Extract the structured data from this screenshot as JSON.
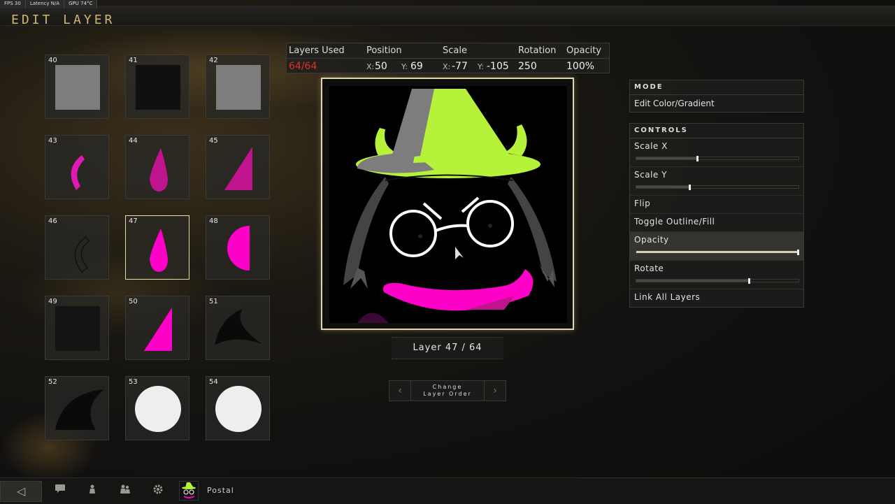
{
  "perf": {
    "fps": "FPS 30",
    "latency": "Latency N/A",
    "gpu": "GPU 74°C"
  },
  "title": "EDIT LAYER",
  "layers": [
    {
      "num": "40",
      "shape": "square",
      "color": "#7d7d7d"
    },
    {
      "num": "41",
      "shape": "square",
      "color": "#101010"
    },
    {
      "num": "42",
      "shape": "square",
      "color": "#7d7d7d"
    },
    {
      "num": "43",
      "shape": "crescent",
      "color": "#e018b4"
    },
    {
      "num": "44",
      "shape": "teardrop",
      "color": "#c0148f"
    },
    {
      "num": "45",
      "shape": "triangle",
      "color": "#c0148f"
    },
    {
      "num": "46",
      "shape": "crescent-outline",
      "color": "#111111"
    },
    {
      "num": "47",
      "shape": "teardrop",
      "color": "#ff00c8",
      "selected": true
    },
    {
      "num": "48",
      "shape": "half-circle",
      "color": "#ff00c8"
    },
    {
      "num": "49",
      "shape": "square",
      "color": "#141414"
    },
    {
      "num": "50",
      "shape": "triangle",
      "color": "#ff00c8"
    },
    {
      "num": "51",
      "shape": "horn",
      "color": "#0a0a0a"
    },
    {
      "num": "52",
      "shape": "horn-big",
      "color": "#0a0a0a"
    },
    {
      "num": "53",
      "shape": "circle",
      "color": "#eeeeee"
    },
    {
      "num": "54",
      "shape": "circle",
      "color": "#eeeeee"
    }
  ],
  "stats": {
    "layers_used_label": "Layers Used",
    "layers_used_value": "64/64",
    "position_label": "Position",
    "pos_x_label": "X:",
    "pos_x": "50",
    "pos_y_label": "Y:",
    "pos_y": "69",
    "scale_label": "Scale",
    "scale_x_label": "X:",
    "scale_x": "-77",
    "scale_y_label": "Y:",
    "scale_y": "-105",
    "rotation_label": "Rotation",
    "rotation": "250",
    "opacity_label": "Opacity",
    "opacity": "100%"
  },
  "layer_counter": "Layer 47 / 64",
  "order": {
    "line1": "Change",
    "line2": "Layer Order",
    "prev": "‹",
    "next": "›"
  },
  "mode": {
    "header": "MODE",
    "item": "Edit Color/Gradient"
  },
  "controls": {
    "header": "CONTROLS",
    "scale_x": {
      "label": "Scale X",
      "level": 0.38
    },
    "scale_y": {
      "label": "Scale Y",
      "level": 0.33
    },
    "flip": "Flip",
    "toggle": "Toggle Outline/Fill",
    "opacity": {
      "label": "Opacity",
      "level": 1.0
    },
    "rotate": {
      "label": "Rotate",
      "level": 0.7
    },
    "link": "Link All Layers"
  },
  "bottom": {
    "back": "◁",
    "postal": "Postal"
  },
  "colors": {
    "accent_gold": "#d2b573",
    "error_red": "#e0302a",
    "lime": "#b6f23a",
    "magenta": "#ff00c8"
  }
}
